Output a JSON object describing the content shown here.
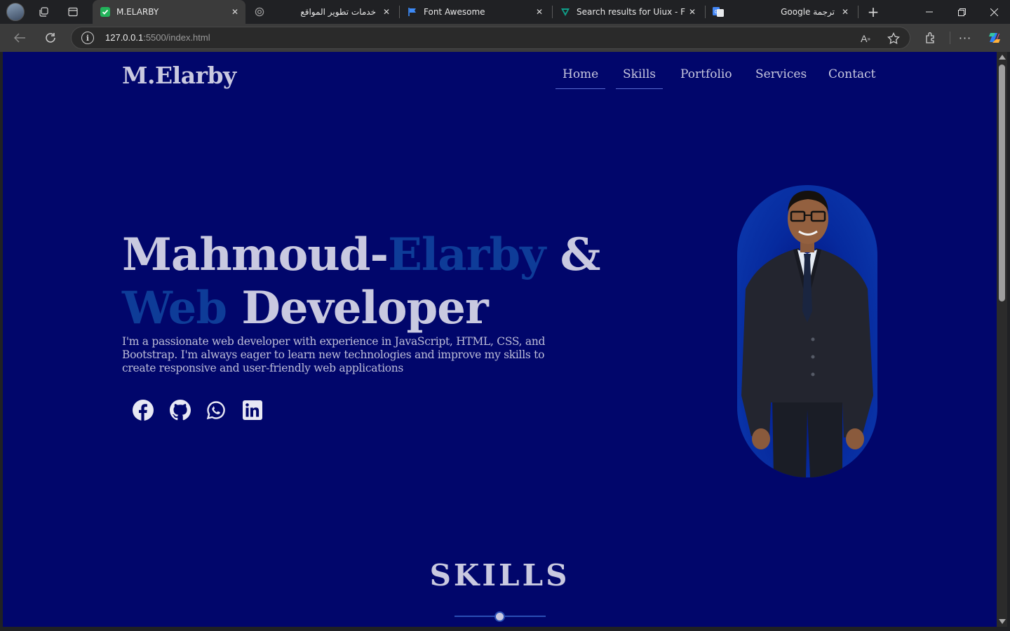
{
  "browser": {
    "tabs": [
      {
        "title": "M.ELARBY",
        "active": true
      },
      {
        "title": "خدمات تطوير المواقع",
        "active": false
      },
      {
        "title": "Font Awesome",
        "active": false
      },
      {
        "title": "Search results for Uiux - Flaticon",
        "active": false
      },
      {
        "title": "Google ترجمة",
        "active": false
      }
    ],
    "url_host": "127.0.0.1",
    "url_path": ":5500/index.html"
  },
  "page": {
    "logo": "M.Elarby",
    "nav": [
      "Home",
      "Skills",
      "Portfolio",
      "Services",
      "Contact"
    ],
    "hero": {
      "line1_name": "Mahmoud-",
      "line1_accent": "Elarby",
      "line1_end": " &",
      "line2_accent": "Web",
      "line2_end": " Developer",
      "bio": "I'm a passionate web developer with experience in JavaScript, HTML, CSS, and Bootstrap. I'm always eager to learn new technologies and improve my skills to create responsive and user-friendly web applications"
    },
    "socials": [
      "facebook-icon",
      "github-icon",
      "whatsapp-icon",
      "linkedin-icon"
    ],
    "section_title": "SKILLS"
  },
  "colors": {
    "page_bg": "#01066b",
    "text": "#c9c9e0",
    "accent": "#0e3c98"
  }
}
